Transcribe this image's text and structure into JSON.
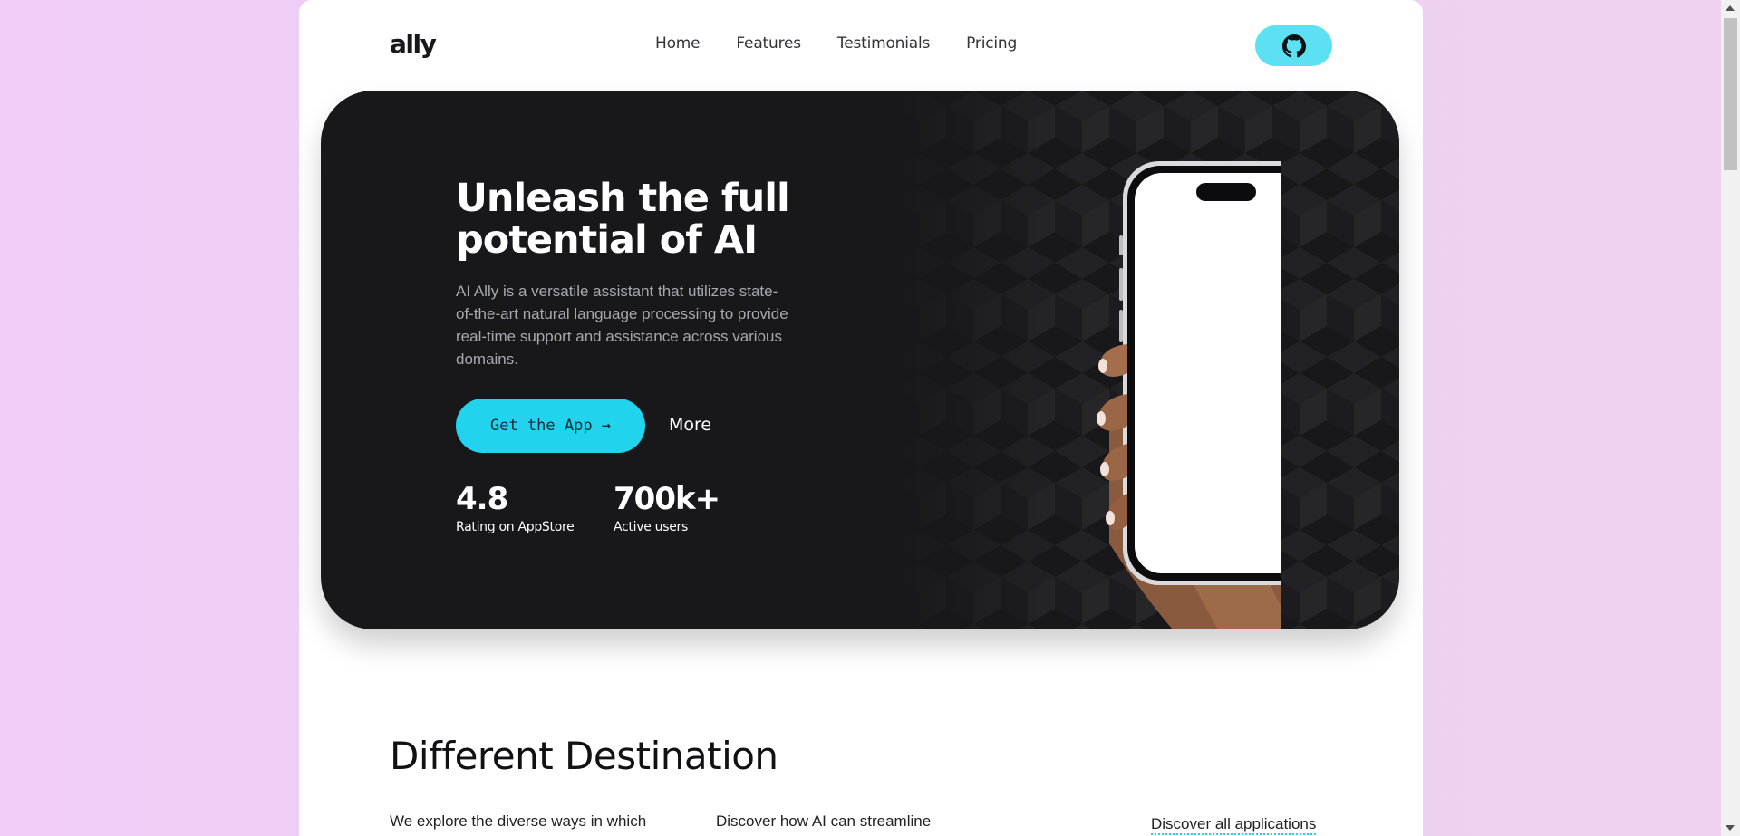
{
  "nav": {
    "logo": "ally",
    "links": [
      "Home",
      "Features",
      "Testimonials",
      "Pricing"
    ],
    "github_icon": "github-icon"
  },
  "hero": {
    "title_line1": "Unleash the full",
    "title_line2": "potential of AI",
    "description": "AI Ally is a versatile assistant that utilizes state-of-the-art natural language processing to provide real-time support and assistance across various domains.",
    "cta_label": "Get the App →",
    "more_label": "More",
    "stats": [
      {
        "value": "4.8",
        "label": "Rating on AppStore"
      },
      {
        "value": "700k+",
        "label": "Active users"
      }
    ]
  },
  "section": {
    "title": "Different Destination",
    "col1": "We explore the diverse ways in which",
    "col2": "Discover how AI can streamline",
    "discover_link": "Discover all applications"
  },
  "colors": {
    "accent": "#22d3ee",
    "github_button": "#5ce1f3",
    "hero_bg": "#18181b",
    "background": "#f1cdf8"
  }
}
